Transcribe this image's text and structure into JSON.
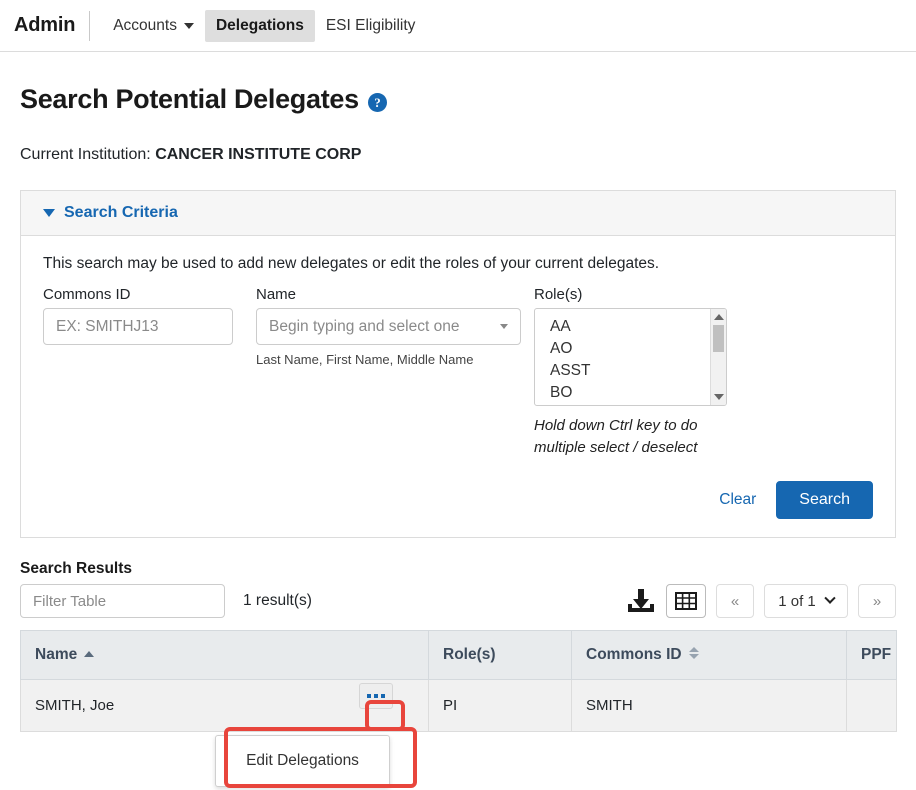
{
  "nav": {
    "brand": "Admin",
    "items": [
      {
        "label": "Accounts",
        "icon": "chevron-down-icon",
        "active": false,
        "hasCaret": true
      },
      {
        "label": "Delegations",
        "active": true,
        "hasCaret": false
      },
      {
        "label": "ESI Eligibility",
        "active": false,
        "hasCaret": false
      }
    ]
  },
  "page": {
    "title": "Search Potential Delegates",
    "help_icon": "help-circle-icon",
    "institution_label": "Current Institution:",
    "institution_value": "CANCER INSTITUTE CORP"
  },
  "search_panel": {
    "header": "Search Criteria",
    "collapse_icon": "triangle-down-icon",
    "intro": "This search may be used to add new delegates or edit the roles of your current delegates.",
    "commons_id": {
      "label": "Commons ID",
      "placeholder": "EX: SMITHJ13",
      "value": ""
    },
    "name": {
      "label": "Name",
      "placeholder": "Begin typing and select one",
      "value": "",
      "hint": "Last Name, First Name, Middle Name",
      "dropdown_icon": "caret-down-icon"
    },
    "roles": {
      "label": "Role(s)",
      "options": [
        "AA",
        "AO",
        "ASST",
        "BO"
      ],
      "hint": "Hold down Ctrl key to do multiple select / deselect",
      "scroll_up_icon": "scroll-up-arrow-icon",
      "scroll_down_icon": "scroll-down-arrow-icon"
    },
    "clear_label": "Clear",
    "search_label": "Search"
  },
  "results": {
    "heading": "Search Results",
    "filter_placeholder": "Filter Table",
    "filter_value": "",
    "count_text": "1 result(s)",
    "toolbar": {
      "download_icon": "download-export-icon",
      "grid_icon": "grid-view-icon",
      "prev_label": "«",
      "next_label": "»",
      "page_label": "1 of 1",
      "page_dropdown_icon": "chevron-down-icon"
    },
    "columns": [
      {
        "label": "Name",
        "sort": "asc"
      },
      {
        "label": "Role(s)",
        "sort": "none"
      },
      {
        "label": "Commons ID",
        "sort": "both"
      },
      {
        "label": "PPF",
        "sort": "none"
      }
    ],
    "rows": [
      {
        "name": "SMITH, Joe",
        "roles": "PI",
        "commons_id": "SMITH",
        "ppf": "",
        "actions_icon": "ellipsis-icon"
      }
    ]
  },
  "action_menu": {
    "items": [
      "Edit Delegations"
    ]
  },
  "colors": {
    "accent_blue": "#1667b1",
    "annotation_red": "#e8453c",
    "table_header_bg": "#e8ebed",
    "panel_header_bg": "#f6f6f6"
  }
}
